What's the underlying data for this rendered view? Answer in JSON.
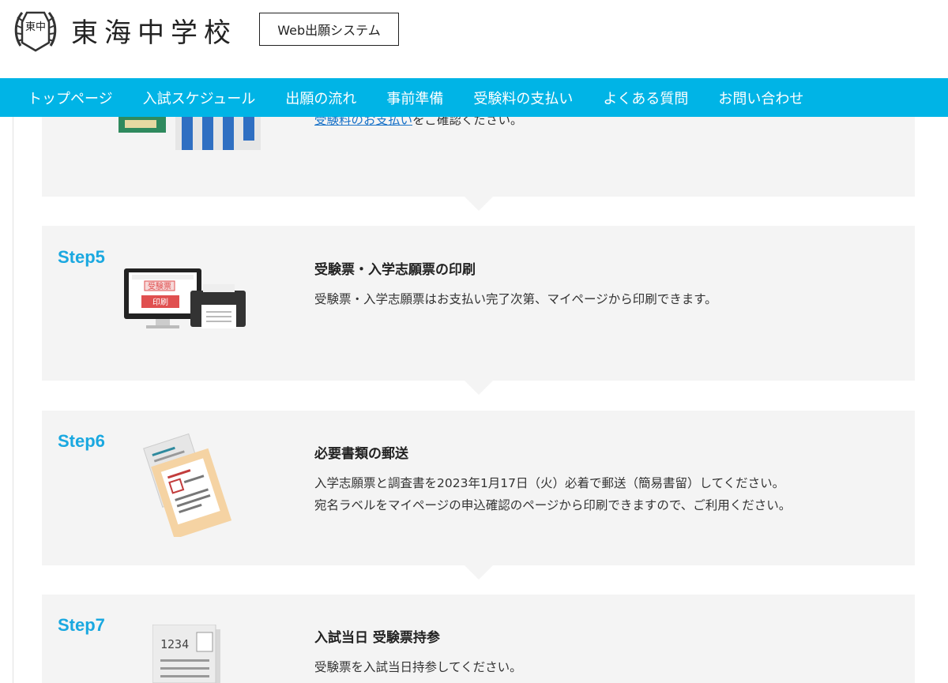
{
  "header": {
    "logo_text": "東中",
    "school_name": "東海中学校",
    "system_button": "Web出願システム"
  },
  "nav": {
    "items": [
      {
        "label": "トップページ"
      },
      {
        "label": "入試スケジュール"
      },
      {
        "label": "出願の流れ"
      },
      {
        "label": "事前準備"
      },
      {
        "label": "受験料の支払い"
      },
      {
        "label": "よくある質問"
      },
      {
        "label": "お問い合わせ"
      }
    ]
  },
  "steps": {
    "step4": {
      "partial_link": "受験料のお支払い",
      "partial_text": "をご確認ください。"
    },
    "step5": {
      "label": "Step5",
      "title": "受験票・入学志願票の印刷",
      "desc1": "受験票・入学志願票はお支払い完了次第、マイページから印刷できます。",
      "screen_text1": "受験票",
      "screen_text2": "印刷"
    },
    "step6": {
      "label": "Step6",
      "title": "必要書類の郵送",
      "desc1": "入学志願票と調査書を2023年1月17日（火）必着で郵送（簡易書留）してください。",
      "desc2": "宛名ラベルをマイページの申込確認のページから印刷できますので、ご利用ください。"
    },
    "step7": {
      "label": "Step7",
      "title": "入試当日 受験票持参",
      "desc1": "受験票を入試当日持参してください。",
      "ticket_number": "1234"
    }
  },
  "colors": {
    "nav_bg": "#00b4e6",
    "step_label": "#1aa8e0",
    "card_bg": "#f4f4f4"
  }
}
